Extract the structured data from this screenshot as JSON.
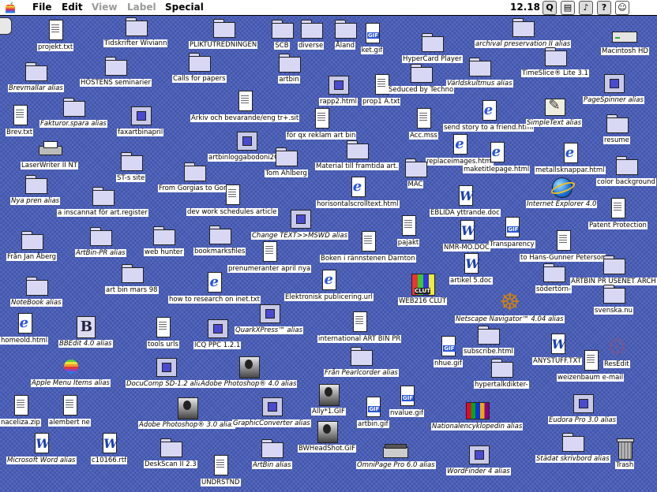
{
  "menubar": {
    "items": [
      {
        "label": "File",
        "enabled": true
      },
      {
        "label": "Edit",
        "enabled": true
      },
      {
        "label": "View",
        "enabled": false
      },
      {
        "label": "Label",
        "enabled": false
      },
      {
        "label": "Special",
        "enabled": true
      }
    ],
    "clock": "12.18"
  },
  "icons": [
    {
      "label": "projekt.txt",
      "type": "doc",
      "alias": false
    },
    {
      "label": "Tidskrifter Wiviann",
      "type": "folder",
      "alias": false
    },
    {
      "label": "PLIKTUTREDNINGEN",
      "type": "folder",
      "alias": false
    },
    {
      "label": "SCB",
      "type": "folder",
      "alias": false
    },
    {
      "label": "diverse",
      "type": "folder",
      "alias": false
    },
    {
      "label": "Åland",
      "type": "folder",
      "alias": false
    },
    {
      "label": "ket.gif",
      "type": "gif",
      "alias": false
    },
    {
      "label": "archival preservation II alias",
      "type": "folder",
      "alias": true
    },
    {
      "label": "HyperCard Player",
      "type": "folder",
      "alias": false
    },
    {
      "label": "Macintosh HD",
      "type": "drive",
      "alias": false
    },
    {
      "label": "Brevmallar alias",
      "type": "folder",
      "alias": true
    },
    {
      "label": "HÖSTENS seminarier",
      "type": "folder",
      "alias": false
    },
    {
      "label": "Calls for papers",
      "type": "folder",
      "alias": false
    },
    {
      "label": "artbin",
      "type": "folder",
      "alias": false
    },
    {
      "label": "rapp2.html",
      "type": "app",
      "alias": false
    },
    {
      "label": "prop1 A.txt",
      "type": "doc",
      "alias": false
    },
    {
      "label": "Seduced by Techno",
      "type": "folder",
      "alias": false
    },
    {
      "label": "Världskultmus alias",
      "type": "folder",
      "alias": true
    },
    {
      "label": "TimeSlice® Lite 3.1",
      "type": "folder",
      "alias": false
    },
    {
      "label": "PageSpinner alias",
      "type": "app",
      "alias": true
    },
    {
      "label": "Fakturor.spara alias",
      "type": "folder",
      "alias": true
    },
    {
      "label": "Brev.txt",
      "type": "doc",
      "alias": false
    },
    {
      "label": "faxartbinapril",
      "type": "app",
      "alias": false
    },
    {
      "label": "Arkiv och bevarande/eng tr+.sit",
      "type": "doc",
      "alias": false
    },
    {
      "label": "för qx reklam art bin",
      "type": "doc",
      "alias": false
    },
    {
      "label": "Acc.mss",
      "type": "doc",
      "alias": false
    },
    {
      "label": "send story to a friend.html",
      "type": "ie",
      "alias": false
    },
    {
      "label": "SimpleText alias",
      "type": "exe",
      "alias": true
    },
    {
      "label": "resume",
      "type": "folder",
      "alias": false
    },
    {
      "label": "LaserWriter II NT",
      "type": "printer",
      "alias": false
    },
    {
      "label": "artbinloggabodoni2QX",
      "type": "app",
      "alias": false
    },
    {
      "label": "replaceimages.html",
      "type": "ie",
      "alias": false
    },
    {
      "label": "maketitlepage.html",
      "type": "ie",
      "alias": false
    },
    {
      "label": "metallsknappar.html",
      "type": "ie",
      "alias": false
    },
    {
      "label": "ST-s site",
      "type": "folder",
      "alias": false
    },
    {
      "label": "Tom Ahlberg",
      "type": "folder",
      "alias": false
    },
    {
      "label": "Material till framtida art.",
      "type": "folder",
      "alias": false
    },
    {
      "label": "color background",
      "type": "folder",
      "alias": false
    },
    {
      "label": "From Gorgias to Gore",
      "type": "folder",
      "alias": false
    },
    {
      "label": "MAC",
      "type": "folder",
      "alias": false
    },
    {
      "label": "Nya pren alias",
      "type": "folder",
      "alias": true
    },
    {
      "label": "Internet Explorer 4.0",
      "type": "globe",
      "alias": true
    },
    {
      "label": "horisontalscrolltext.html",
      "type": "ie",
      "alias": false
    },
    {
      "label": "a inscannat för art.register",
      "type": "folder",
      "alias": false
    },
    {
      "label": "dev work schedules article",
      "type": "doc",
      "alias": false
    },
    {
      "label": "EBLIDA yttrande.doc",
      "type": "word",
      "alias": false
    },
    {
      "label": "Patent Protection",
      "type": "doc",
      "alias": false
    },
    {
      "label": "Change TEXT>>MSWD alias",
      "type": "app",
      "alias": true
    },
    {
      "label": "pajakt",
      "type": "doc",
      "alias": false
    },
    {
      "label": "NMR-MO.DOC",
      "type": "word",
      "alias": false
    },
    {
      "label": "Transparency",
      "type": "gif",
      "alias": false
    },
    {
      "label": "ArtBin-PR alias",
      "type": "folder",
      "alias": true
    },
    {
      "label": "Från Jan Åberg",
      "type": "folder",
      "alias": false
    },
    {
      "label": "web hunter",
      "type": "folder",
      "alias": false
    },
    {
      "label": "bookmarksfiles",
      "type": "folder",
      "alias": false
    },
    {
      "label": "Boken i rännstenen Darnton",
      "type": "doc",
      "alias": false
    },
    {
      "label": "to Hans-Gunner Peterson",
      "type": "doc",
      "alias": false
    },
    {
      "label": "prenumeranter april nya",
      "type": "doc",
      "alias": false
    },
    {
      "label": "artikel 5.doc",
      "type": "word",
      "alias": false
    },
    {
      "label": "ARTBIN PR USENET ARCH",
      "type": "folder",
      "alias": false
    },
    {
      "label": "art bin mars 98",
      "type": "folder",
      "alias": false
    },
    {
      "label": "WEB216 CLUT",
      "type": "clut",
      "alias": false
    },
    {
      "label": "södertörn-",
      "type": "folder",
      "alias": false
    },
    {
      "label": "NoteBook alias",
      "type": "folder",
      "alias": true
    },
    {
      "label": "how to research on inet.txt",
      "type": "ie",
      "alias": false
    },
    {
      "label": "Elektronisk publicering.url",
      "type": "ie",
      "alias": false
    },
    {
      "label": "svenska.nu",
      "type": "folder",
      "alias": false
    },
    {
      "label": "Netscape Navigator™ 4.04 alias",
      "type": "wheel",
      "alias": true
    },
    {
      "label": "homeold.html",
      "type": "ie",
      "alias": false
    },
    {
      "label": "BBEdit 4.0 alias",
      "type": "bbedit",
      "alias": true
    },
    {
      "label": "QuarkXPress™ alias",
      "type": "app",
      "alias": true
    },
    {
      "label": "tools urls",
      "type": "doc",
      "alias": false
    },
    {
      "label": "ICQ PPC 1.2.1",
      "type": "app",
      "alias": false
    },
    {
      "label": "international ART BIN PR",
      "type": "doc",
      "alias": false
    },
    {
      "label": "subscribe.html",
      "type": "folder",
      "alias": false
    },
    {
      "label": "ANYSTUFF.TXT",
      "type": "word",
      "alias": false
    },
    {
      "label": "ResEdit",
      "type": "gear",
      "alias": false
    },
    {
      "label": "Apple Menu Items alias",
      "type": "apple",
      "alias": true
    },
    {
      "label": "nhue.gif",
      "type": "gif",
      "alias": false
    },
    {
      "label": "DocuComp SD-1.2 alias",
      "type": "app",
      "alias": true
    },
    {
      "label": "Adobe Photoshop® 4.0 alias",
      "type": "photo",
      "alias": true
    },
    {
      "label": "Från Pearlcorder alias",
      "type": "folder",
      "alias": true
    },
    {
      "label": "weizenbaum e-mail",
      "type": "doc",
      "alias": false
    },
    {
      "label": "hypertalkdikter-",
      "type": "folder",
      "alias": false
    },
    {
      "label": "naceliza.zip",
      "type": "doc",
      "alias": false
    },
    {
      "label": "alembert ne",
      "type": "doc",
      "alias": false
    },
    {
      "label": "Ally*1.GIF",
      "type": "photo",
      "alias": false
    },
    {
      "label": "nvalue.gif",
      "type": "gif",
      "alias": false
    },
    {
      "label": "Adobe Photoshop® 3.0 alias",
      "type": "photo",
      "alias": true
    },
    {
      "label": "GraphicConverter alias",
      "type": "app",
      "alias": true
    },
    {
      "label": "artbin.gif",
      "type": "gif",
      "alias": false
    },
    {
      "label": "Nationalencyklopedin alias",
      "type": "stack",
      "alias": true
    },
    {
      "label": "Eudora Pro 3.0 alias",
      "type": "app",
      "alias": true
    },
    {
      "label": "Microsoft Word alias",
      "type": "word",
      "alias": true
    },
    {
      "label": "c10166.rtf",
      "type": "word",
      "alias": false
    },
    {
      "label": "BWHeadShot.GIF",
      "type": "photo",
      "alias": false
    },
    {
      "label": "OmniPage Pro 6.0 alias",
      "type": "scanner",
      "alias": true
    },
    {
      "label": "DeskScan II 2.3",
      "type": "folder",
      "alias": false
    },
    {
      "label": "ArtBin alias",
      "type": "folder",
      "alias": true
    },
    {
      "label": "Städat skrivbord alias",
      "type": "folder",
      "alias": true
    },
    {
      "label": "Trash",
      "type": "trash",
      "alias": false
    },
    {
      "label": "UNDRSTND",
      "type": "doc",
      "alias": false
    },
    {
      "label": "WordFinder 4 alias",
      "type": "app",
      "alias": true
    }
  ]
}
